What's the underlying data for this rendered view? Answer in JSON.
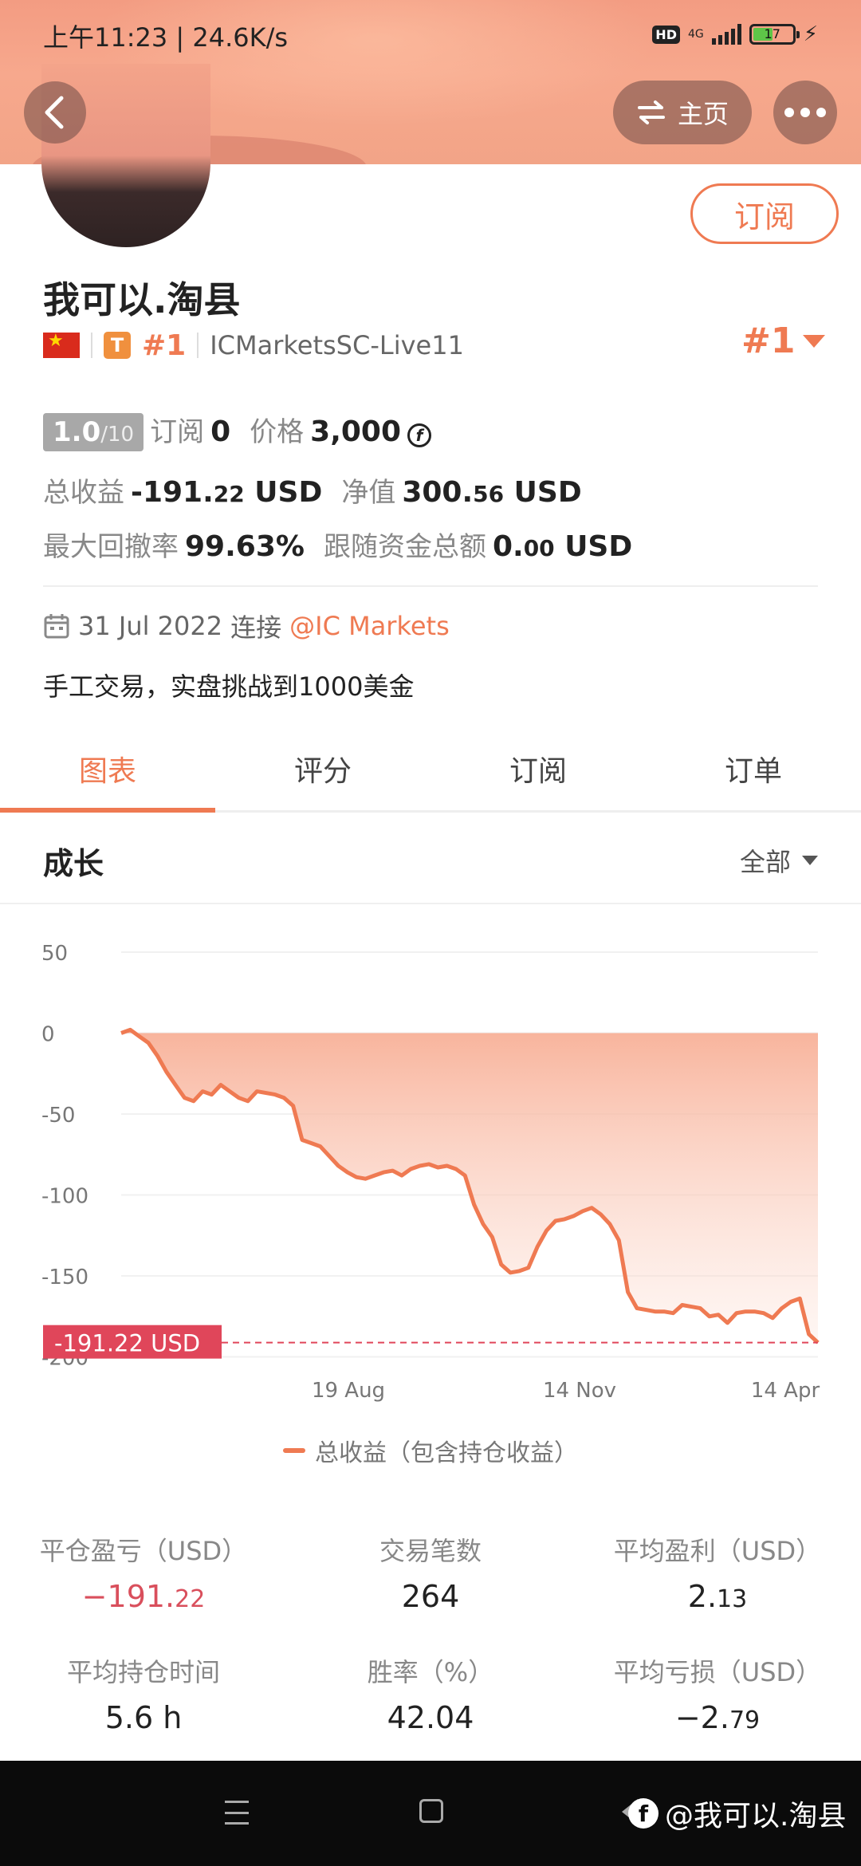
{
  "status_bar": {
    "time": "上午11:23 | 24.6K/s",
    "hd": "HD",
    "net": "4G",
    "battery": "17"
  },
  "header": {
    "home_label": "主页"
  },
  "profile": {
    "subscribe_label": "订阅",
    "name": "我可以.淘县",
    "rank": "#1",
    "server": "ICMarketsSC-Live11",
    "rank_right": "#1",
    "tier_badge": "T"
  },
  "stats": {
    "score": "1.0",
    "score_max": "/10",
    "subscriptions_label": "订阅",
    "subscriptions_value": "0",
    "price_label": "价格",
    "price_value": "3,000",
    "total_profit_label": "总收益",
    "total_profit_int": "-191.",
    "total_profit_dec": "22",
    "currency": "USD",
    "equity_label": "净值",
    "equity_int": "300.",
    "equity_dec": "56",
    "max_drawdown_label": "最大回撤率",
    "max_drawdown_value": "99.63%",
    "follow_funds_label": "跟随资金总额",
    "follow_funds_int": "0.",
    "follow_funds_dec": "00"
  },
  "connection": {
    "date": "31 Jul 2022",
    "connect_label": "连接",
    "broker": "@IC Markets"
  },
  "description": "手工交易，实盘挑战到1000美金",
  "tabs": [
    {
      "label": "图表",
      "active": true
    },
    {
      "label": "评分",
      "active": false
    },
    {
      "label": "订阅",
      "active": false
    },
    {
      "label": "订单",
      "active": false
    }
  ],
  "growth": {
    "title": "成长",
    "filter": "全部"
  },
  "chart_data": {
    "type": "area",
    "y_ticks": [
      "50",
      "0",
      "-50",
      "-100",
      "-150",
      "-200"
    ],
    "ylim": [
      -200,
      50
    ],
    "x_ticks": [
      "19 Aug",
      "14 Nov",
      "14 Apr"
    ],
    "current_label": "-191.22 USD",
    "current_value": -191.22,
    "series": [
      {
        "name": "总收益（包含持仓收益）",
        "values": [
          0,
          2,
          -2,
          -6,
          -14,
          -24,
          -32,
          -40,
          -42,
          -36,
          -38,
          -32,
          -36,
          -40,
          -42,
          -36,
          -37,
          -38,
          -40,
          -45,
          -66,
          -68,
          -70,
          -76,
          -82,
          -86,
          -89,
          -90,
          -88,
          -86,
          -85,
          -88,
          -84,
          -82,
          -81,
          -83,
          -82,
          -84,
          -88,
          -106,
          -118,
          -126,
          -143,
          -148,
          -147,
          -145,
          -132,
          -122,
          -116,
          -115,
          -113,
          -110,
          -108,
          -112,
          -118,
          -128,
          -160,
          -170,
          -171,
          -172,
          -172,
          -173,
          -168,
          -169,
          -170,
          -175,
          -174,
          -179,
          -173,
          -172,
          -172,
          -173,
          -176,
          -170,
          -166,
          -164,
          -186,
          -191.22
        ]
      }
    ]
  },
  "legend": "总收益（包含持仓收益）",
  "metrics": [
    {
      "label": "平仓盈亏（USD）",
      "value_main": "−191.",
      "value_small": "22",
      "negative": true
    },
    {
      "label": "交易笔数",
      "value_main": "264",
      "value_small": "",
      "negative": false
    },
    {
      "label": "平均盈利（USD）",
      "value_main": "2.",
      "value_small": "13",
      "negative": false
    },
    {
      "label": "平均持仓时间",
      "value_main": "5.6 h",
      "value_small": "",
      "negative": false
    },
    {
      "label": "胜率（%）",
      "value_main": "42.04",
      "value_small": "",
      "negative": false
    },
    {
      "label": "平均亏损（USD）",
      "value_main": "−2.",
      "value_small": "79",
      "negative": false
    }
  ],
  "watermark": "@我可以.淘县",
  "colors": {
    "accent": "#ef7a52",
    "negative": "#d94f5c",
    "label_bg": "#e0465a"
  }
}
